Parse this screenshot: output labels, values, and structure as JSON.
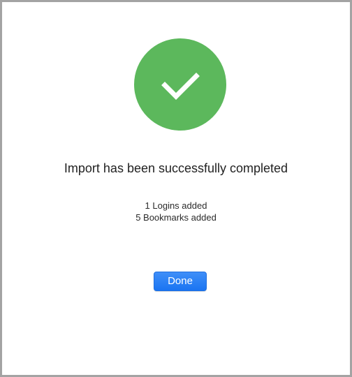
{
  "dialog": {
    "title": "Import has been successfully completed",
    "summary": [
      "1 Logins added",
      "5 Bookmarks added"
    ],
    "done_label": "Done",
    "icon": "checkmark-circle-icon"
  },
  "colors": {
    "success_green": "#5cb85c",
    "button_blue": "#1a74f2",
    "border_gray": "#a3a3a3"
  }
}
